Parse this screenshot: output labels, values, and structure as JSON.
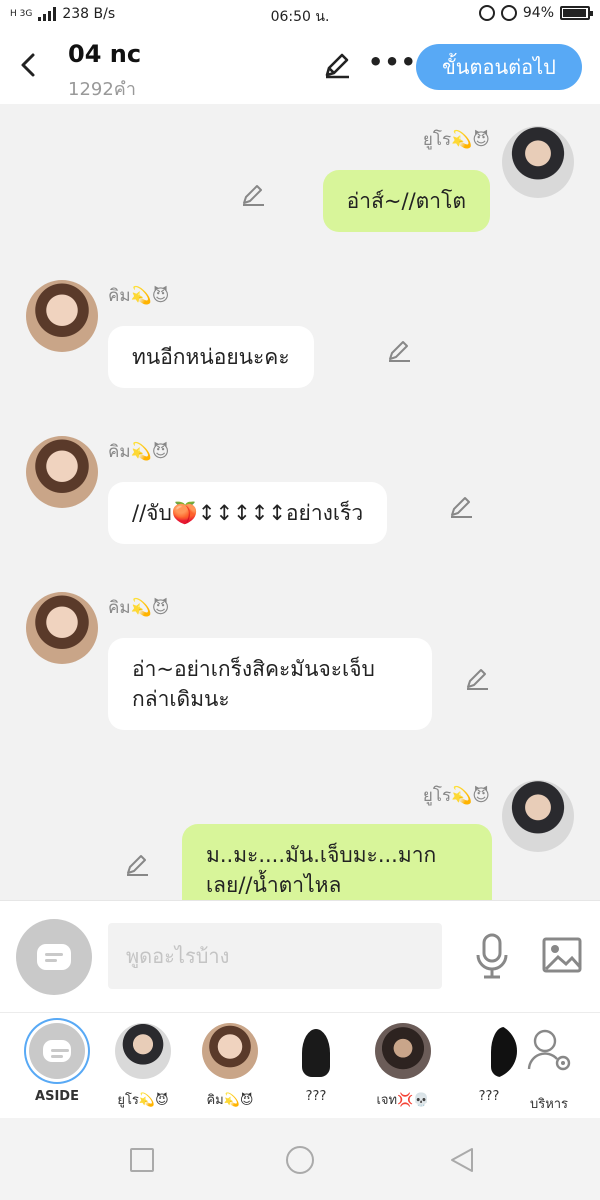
{
  "status_bar": {
    "network": "H 3G",
    "speed": "238 B/s",
    "time": "06:50 น.",
    "battery_percent": "94%",
    "battery_level": 0.94
  },
  "header": {
    "back_icon": "chevron-left-icon",
    "title": "04 nc",
    "subtitle": "1292คำ",
    "edit_icon": "pencil-icon",
    "more_icon": "more-dots-icon",
    "next_button": "ขั้นตอนต่อไป",
    "accent_color": "#58a9f5"
  },
  "messages": [
    {
      "side": "right",
      "name": "ยูโร💫😈",
      "text": "อ่าส์~//ตาโต",
      "color": "#d8f59a"
    },
    {
      "side": "left",
      "name": "คิม💫😈",
      "text": "ทนอีกหน่อยนะคะ",
      "color": "#ffffff"
    },
    {
      "side": "left",
      "name": "คิม💫😈",
      "text": "//จับ🍑↕↕↕↕↕อย่างเร็ว",
      "color": "#ffffff"
    },
    {
      "side": "left",
      "name": "คิม💫😈",
      "text": "อ่า~อย่าเกร็งสิคะมันจะเจ็บกล่าเดิมนะ",
      "color": "#ffffff"
    },
    {
      "side": "right",
      "name": "ยูโร💫😈",
      "text": "ม..มะ....มัน.เจ็บมะ...มากเลย//น้ำตาไหล",
      "color": "#d8f59a"
    }
  ],
  "input": {
    "aside_icon": "chat-bubble-icon",
    "placeholder": "พูดอะไรบ้าง",
    "mic_icon": "microphone-icon",
    "image_icon": "image-icon"
  },
  "characters": [
    {
      "label": "ASIDE"
    },
    {
      "label": "ยูโร💫😈"
    },
    {
      "label": "คิม💫😈"
    },
    {
      "label": "???"
    },
    {
      "label": "เจท💢💀"
    },
    {
      "label": "???"
    },
    {
      "label": "บริหาร"
    }
  ],
  "nav": {
    "recent_icon": "square-icon",
    "home_icon": "circle-icon",
    "back_icon": "triangle-back-icon"
  }
}
